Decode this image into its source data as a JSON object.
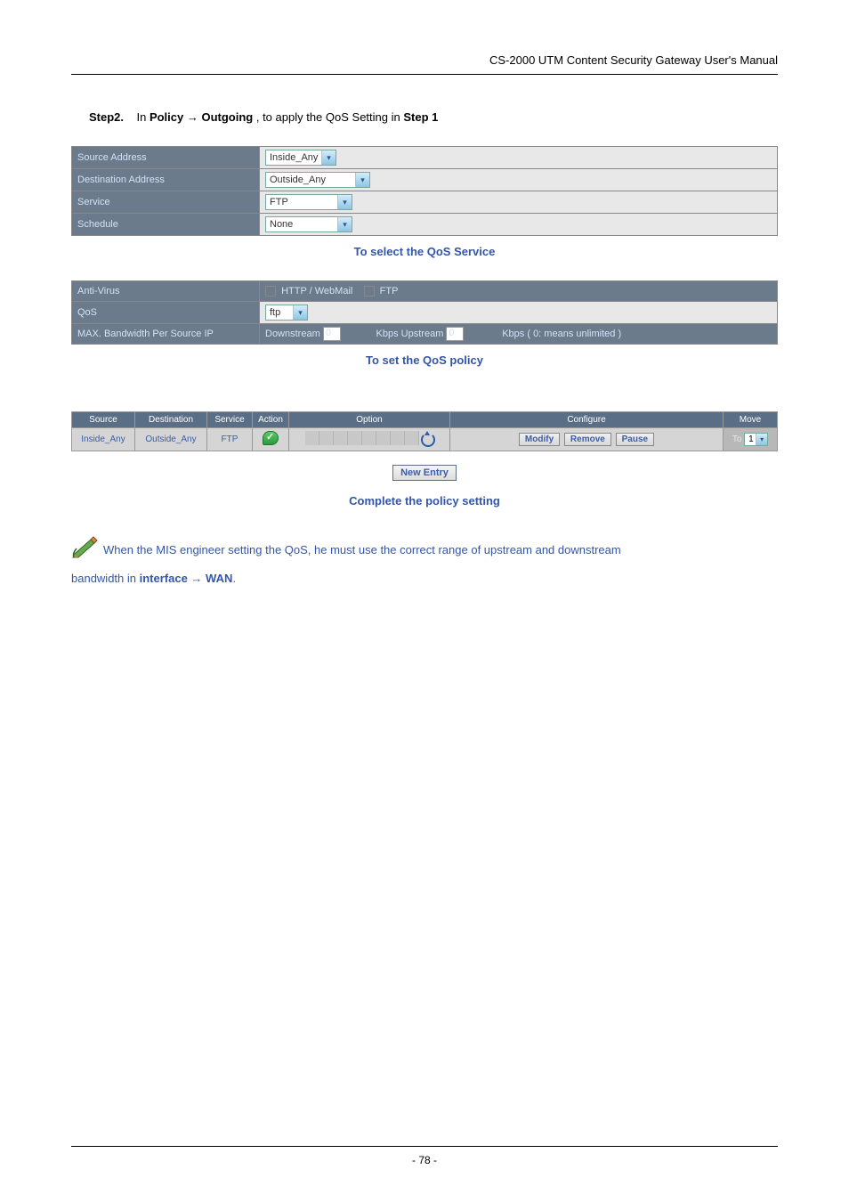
{
  "header": {
    "title": "CS-2000 UTM Content Security Gateway User's Manual"
  },
  "step": {
    "label": "Step2.",
    "text_pre": "In ",
    "bold1": "Policy ",
    "arrow": "→",
    "bold2": " Outgoing ",
    "text_mid": ", to apply the QoS Setting in ",
    "bold3": "Step 1"
  },
  "form1": {
    "rows": [
      {
        "label": "Source Address",
        "value": "Inside_Any"
      },
      {
        "label": "Destination Address",
        "value": "Outside_Any"
      },
      {
        "label": "Service",
        "value": "FTP"
      },
      {
        "label": "Schedule",
        "value": "None"
      }
    ]
  },
  "caption1": "To select the QoS Service",
  "form2": {
    "antivirus_label": "Anti-Virus",
    "av_opt1": "HTTP / WebMail",
    "av_opt2": "FTP",
    "qos_label": "QoS",
    "qos_value": "ftp",
    "bw_label": "MAX. Bandwidth Per Source IP",
    "down_label": "Downstream",
    "down_value": "0",
    "up_label": "Kbps Upstream",
    "up_value": "0",
    "bw_note": "Kbps ( 0: means unlimited )"
  },
  "caption2": "To set the QoS policy",
  "policy_table": {
    "headers": [
      "Source",
      "Destination",
      "Service",
      "Action",
      "Option",
      "Configure",
      "Move"
    ],
    "row": {
      "source": "Inside_Any",
      "destination": "Outside_Any",
      "service": "FTP",
      "btn_modify": "Modify",
      "btn_remove": "Remove",
      "btn_pause": "Pause",
      "move_label": "To",
      "move_value": "1"
    }
  },
  "new_entry": "New Entry",
  "caption3": "Complete the policy setting",
  "note": {
    "line": "When the MIS engineer setting the QoS, he must use the correct range of upstream and downstream",
    "line2_pre": "bandwidth in ",
    "line2_bold": "interface → WAN",
    "line2_post": "."
  },
  "footer": {
    "page": "- 78 -"
  }
}
